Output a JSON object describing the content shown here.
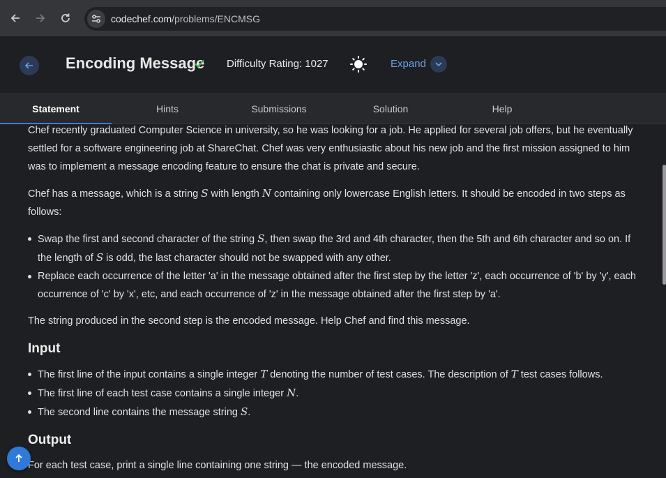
{
  "browser": {
    "url_host": "codechef.com",
    "url_path": "/problems/ENCMSG"
  },
  "header": {
    "title": "Encoding Message",
    "difficulty": "Difficulty Rating: 1027",
    "expand_label": "Expand",
    "check_color": "#4caf50"
  },
  "tabs": [
    {
      "label": "Statement",
      "active": true
    },
    {
      "label": "Hints"
    },
    {
      "label": "Submissions"
    },
    {
      "label": "Solution"
    },
    {
      "label": "Help"
    }
  ],
  "statement": {
    "p1": "Chef recently graduated Computer Science in university, so he was looking for a job. He applied for several job offers, but he eventually settled for a software engineering job at ShareChat. Chef was very enthusiastic about his new job and the first mission assigned to him was to implement a message encoding feature to ensure the chat is private and secure.",
    "p2_a": "Chef has a message, which is a string ",
    "p2_S": "S",
    "p2_b": " with length ",
    "p2_N": "N",
    "p2_c": " containing only lowercase English letters. It should be encoded in two steps as follows:",
    "b1_a": "Swap the first and second character of the string ",
    "b1_S1": "S",
    "b1_b": ", then swap the 3rd and 4th character, then the 5th and 6th character and so on. If the length of ",
    "b1_S2": "S",
    "b1_c": " is odd, the last character should not be swapped with any other.",
    "b2": "Replace each occurrence of the letter 'a' in the message obtained after the first step by the letter 'z', each occurrence of 'b' by 'y', each occurrence of 'c' by 'x', etc, and each occurrence of 'z' in the message obtained after the first step by 'a'.",
    "p3": "The string produced in the second step is the encoded message. Help Chef and find this message."
  },
  "input_section": {
    "heading": "Input",
    "i1_a": "The first line of the input contains a single integer ",
    "i1_T1": "T",
    "i1_b": " denoting the number of test cases. The description of ",
    "i1_T2": "T",
    "i1_c": " test cases follows.",
    "i2_a": "The first line of each test case contains a single integer ",
    "i2_N": "N",
    "i2_b": ".",
    "i3_a": "The second line contains the message string ",
    "i3_S": "S",
    "i3_b": "."
  },
  "output_section": {
    "heading": "Output",
    "o1": "For each test case, print a single line containing one string — the encoded message."
  },
  "icons": {
    "back": "arrow-left-icon",
    "forward": "arrow-right-icon",
    "reload": "reload-icon",
    "site_info": "tune-icon",
    "check": "check-icon",
    "theme": "sun-icon",
    "expand": "chevron-down-icon",
    "scroll_top": "arrow-up-icon"
  },
  "colors": {
    "accent": "#3a7fd8",
    "link": "#6b9ee6",
    "background": "#1e1f22"
  }
}
